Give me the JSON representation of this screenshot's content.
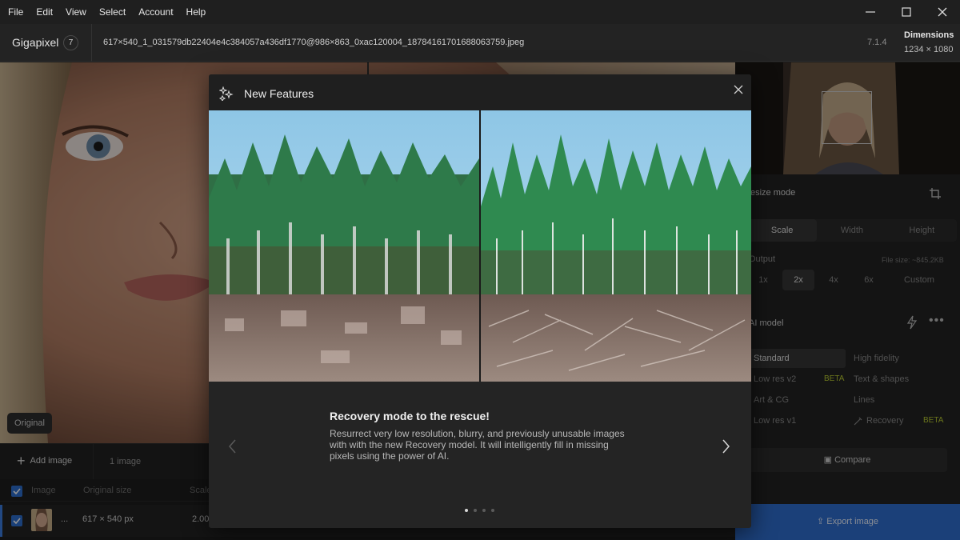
{
  "menu": [
    "File",
    "Edit",
    "View",
    "Select",
    "Account",
    "Help"
  ],
  "app": {
    "name": "Gigapixel",
    "badge": "7",
    "version": "7.1.4"
  },
  "file": {
    "name": "617×540_1_031579db22404e4c384057a436df1770@986×863_0xac120004_18784161701688063759.jpeg"
  },
  "dimensions": {
    "label": "Dimensions",
    "value": "1234 × 1080"
  },
  "canvas": {
    "original_label": "Original"
  },
  "bottombar": {
    "add_image": "Add image",
    "count": "1 image"
  },
  "table": {
    "headers": {
      "image": "Image",
      "original_size": "Original size",
      "scale": "Scale"
    },
    "rows": [
      {
        "name": "...",
        "original_size": "617 × 540 px",
        "scale": "2.00"
      }
    ]
  },
  "right_panel": {
    "resize_mode": {
      "title": "esize mode",
      "options": [
        "Scale",
        "Width",
        "Height"
      ],
      "selected": "Scale"
    },
    "output": {
      "title": "Output",
      "file_size": "File size: ~845.2KB",
      "options": [
        "1x",
        "2x",
        "4x",
        "6x",
        "Custom"
      ],
      "selected": "2x"
    },
    "ai_model": {
      "title": "AI model",
      "models": [
        {
          "name": "Standard",
          "beta": ""
        },
        {
          "name": "High fidelity",
          "beta": ""
        },
        {
          "name": "Low res v2",
          "beta": "BETA"
        },
        {
          "name": "Text & shapes",
          "beta": ""
        },
        {
          "name": "Art & CG",
          "beta": ""
        },
        {
          "name": "Lines",
          "beta": ""
        },
        {
          "name": "Low res v1",
          "beta": ""
        },
        {
          "name": "Recovery",
          "beta": "BETA"
        }
      ],
      "selected": "Standard"
    },
    "compare": "Compare",
    "export": "Export image"
  },
  "dialog": {
    "title": "New Features",
    "feature_title": "Recovery mode to the rescue!",
    "feature_description": "Resurrect very low resolution, blurry, and previously unusable images with with the new Recovery model. It will intelligently fill in missing pixels using the power of AI.",
    "page_count": 4,
    "current_page": 1
  },
  "colors": {
    "accent": "#2f6fd0",
    "beta": "#b7c931",
    "background": "#1c1c1c"
  }
}
